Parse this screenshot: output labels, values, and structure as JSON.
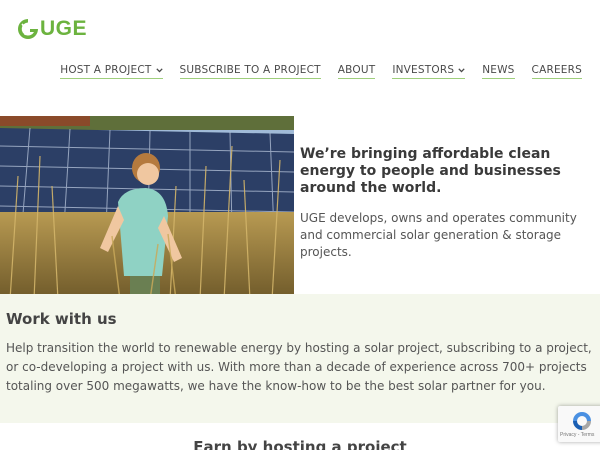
{
  "brand": {
    "name": "UGE",
    "color": "#6cb33f"
  },
  "nav": {
    "items": [
      {
        "label": "HOST A PROJECT",
        "has_dropdown": true
      },
      {
        "label": "SUBSCRIBE TO A PROJECT",
        "has_dropdown": false
      },
      {
        "label": "ABOUT",
        "has_dropdown": false
      },
      {
        "label": "INVESTORS",
        "has_dropdown": true
      },
      {
        "label": "NEWS",
        "has_dropdown": false
      },
      {
        "label": "CAREERS",
        "has_dropdown": false
      }
    ],
    "underline_color": "#9fcf7c"
  },
  "hero": {
    "image": "child-in-tall-grass-near-solar-panels",
    "title": "We’re bringing affordable clean energy to people and businesses around the world.",
    "description": "UGE develops, owns and operates community and commercial solar generation & storage projects."
  },
  "work": {
    "title": "Work with us",
    "body": "Help transition the world to renewable energy by hosting a solar project, subscribing to a project, or co-developing a project with us. With more than a decade of experience across 700+ projects totaling over 500 megawatts, we have the know-how to be the best solar partner for you.",
    "background": "#f4f7ec"
  },
  "next_section": {
    "title": "Earn by hosting a project"
  },
  "recaptcha": {
    "text": "Privacy - Terms"
  }
}
